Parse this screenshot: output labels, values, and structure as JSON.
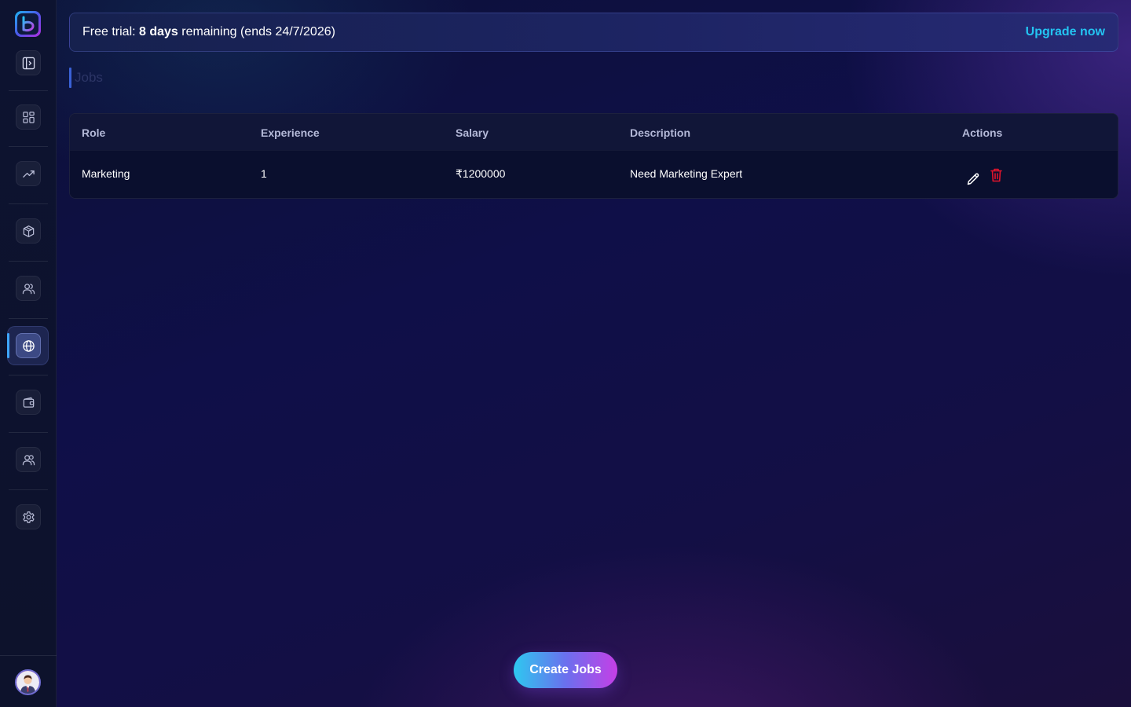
{
  "banner": {
    "prefix": "Free trial: ",
    "days": "8 days",
    "suffix": " remaining (ends 24/7/2026)",
    "upgrade_label": "Upgrade now"
  },
  "page": {
    "title": "Jobs"
  },
  "sidebar": {
    "items": [
      {
        "icon": "dashboard-grid-icon"
      },
      {
        "icon": "trending-up-icon"
      },
      {
        "icon": "box-icon"
      },
      {
        "icon": "users-icon"
      },
      {
        "icon": "globe-icon",
        "active": true
      },
      {
        "icon": "wallet-icon"
      },
      {
        "icon": "team-icon"
      },
      {
        "icon": "gear-icon"
      }
    ]
  },
  "table": {
    "headers": {
      "role": "Role",
      "experience": "Experience",
      "salary": "Salary",
      "description": "Description",
      "actions": "Actions"
    },
    "rows": [
      {
        "role": "Marketing",
        "experience": "1",
        "salary": "₹1200000",
        "description": "Need Marketing Expert"
      }
    ]
  },
  "create_button": {
    "label": "Create Jobs"
  },
  "colors": {
    "accent": "#23c4f2",
    "delete": "#e0142c",
    "active_indicator": "#3ea6ff"
  }
}
